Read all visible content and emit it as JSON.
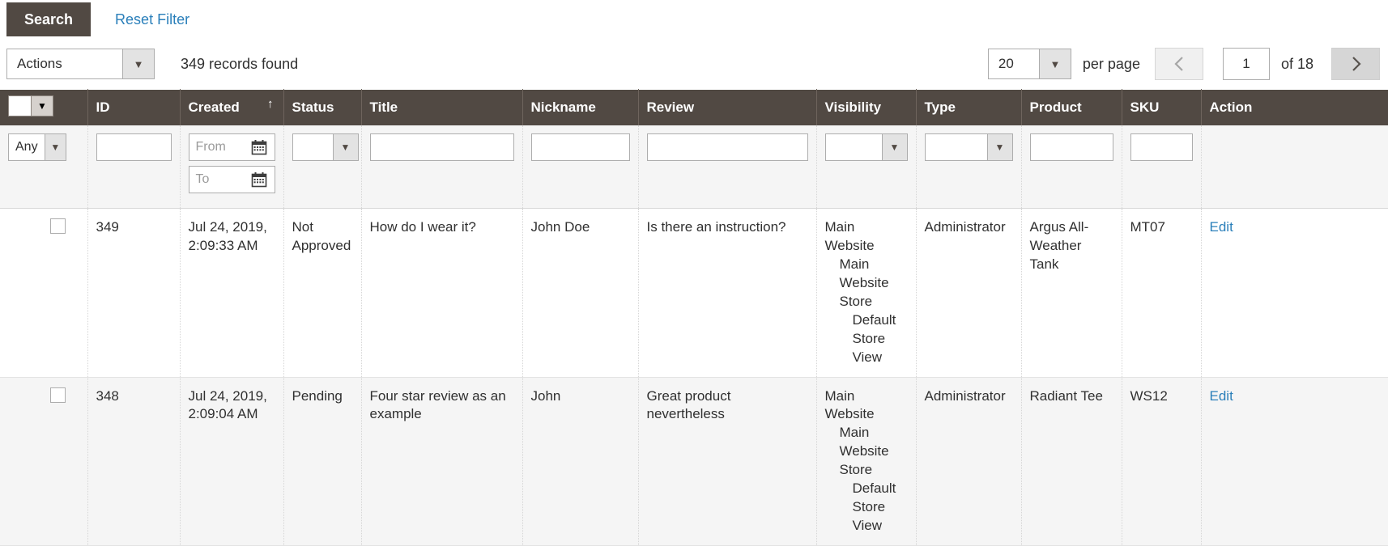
{
  "toolbar": {
    "search_label": "Search",
    "reset_filter_label": "Reset Filter",
    "actions_value": "Actions",
    "records_found": "349 records found"
  },
  "pager": {
    "per_page_value": "20",
    "per_page_label": "per page",
    "prev_icon": "chevron-left-icon",
    "next_icon": "chevron-right-icon",
    "current_page": "1",
    "of_label": "of 18"
  },
  "grid": {
    "columns": [
      {
        "key": "checkbox",
        "label": ""
      },
      {
        "key": "id",
        "label": "ID"
      },
      {
        "key": "created",
        "label": "Created",
        "sorted": "asc",
        "sort_icon": "sort-arrow-up-icon"
      },
      {
        "key": "status",
        "label": "Status"
      },
      {
        "key": "title",
        "label": "Title"
      },
      {
        "key": "nickname",
        "label": "Nickname"
      },
      {
        "key": "review",
        "label": "Review"
      },
      {
        "key": "visibility",
        "label": "Visibility"
      },
      {
        "key": "type",
        "label": "Type"
      },
      {
        "key": "product",
        "label": "Product"
      },
      {
        "key": "sku",
        "label": "SKU"
      },
      {
        "key": "action",
        "label": "Action"
      }
    ],
    "filters": {
      "mass_select_value": "Any",
      "id_value": "",
      "created_from_placeholder": "From",
      "created_to_placeholder": "To",
      "status_value": "",
      "title_value": "",
      "nickname_value": "",
      "review_value": "",
      "visibility_value": "",
      "type_value": "",
      "product_value": "",
      "sku_value": ""
    },
    "rows": [
      {
        "id": "349",
        "created": "Jul 24, 2019, 2:09:33 AM",
        "status": "Not Approved",
        "title": "How do I wear it?",
        "nickname": "John Doe",
        "review": "Is there an instruction?",
        "visibility_l1": "Main Website",
        "visibility_l2": "Main Website Store",
        "visibility_l3": "Default Store View",
        "type": "Administrator",
        "product": "Argus All-Weather Tank",
        "sku": "MT07",
        "action": "Edit"
      },
      {
        "id": "348",
        "created": "Jul 24, 2019, 2:09:04 AM",
        "status": "Pending",
        "title": "Four star review as an example",
        "nickname": "John",
        "review": "Great product nevertheless",
        "visibility_l1": "Main Website",
        "visibility_l2": "Main Website Store",
        "visibility_l3": "Default Store View",
        "type": "Administrator",
        "product": "Radiant Tee",
        "sku": "WS12",
        "action": "Edit"
      }
    ]
  },
  "colors": {
    "header_bg": "#514943",
    "link": "#2a7fba",
    "filter_bg": "#f5f5f5"
  }
}
